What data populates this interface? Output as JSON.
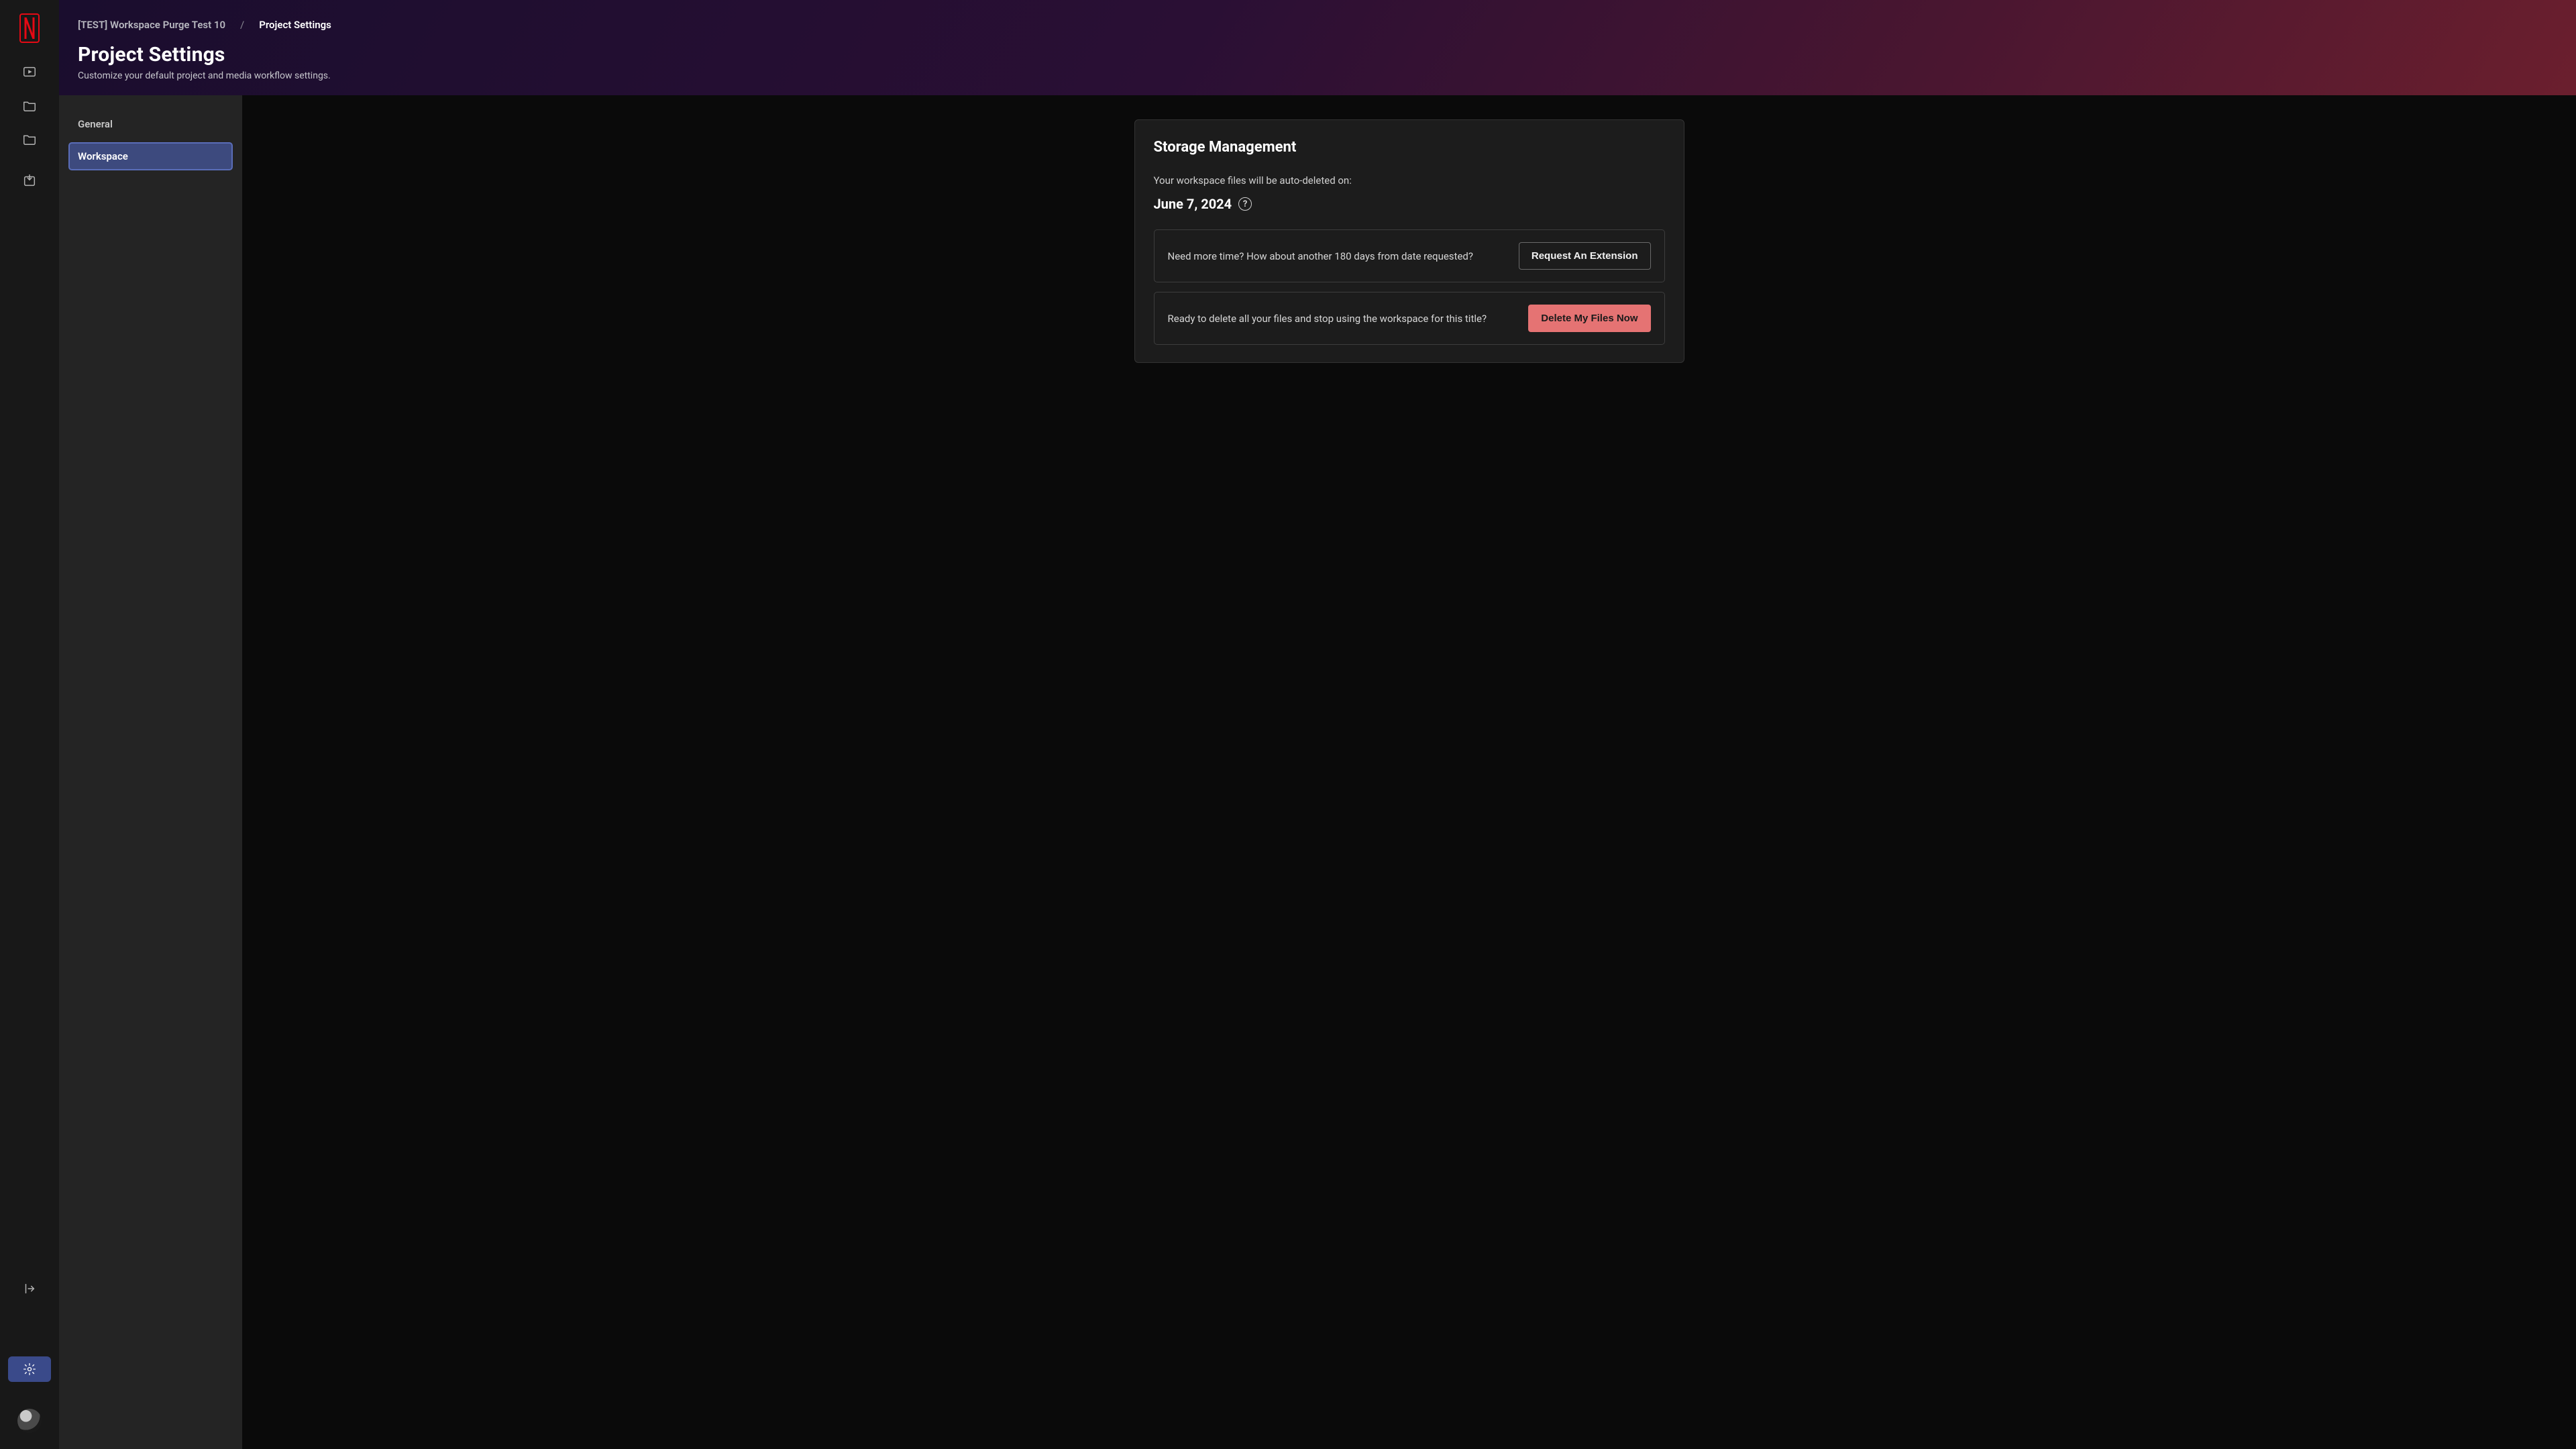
{
  "brand": {
    "letter": "N"
  },
  "breadcrumb": {
    "parent": "[TEST] Workspace Purge Test 10",
    "separator": "/",
    "current": "Project Settings"
  },
  "hero": {
    "title": "Project Settings",
    "subtitle": "Customize your default project and media workflow settings."
  },
  "settings_nav": {
    "items": [
      {
        "label": "General",
        "active": false
      },
      {
        "label": "Workspace",
        "active": true
      }
    ]
  },
  "storage": {
    "title": "Storage Management",
    "auto_delete_label": "Your workspace files will be auto-deleted on:",
    "auto_delete_date": "June 7, 2024",
    "help_glyph": "?",
    "extension": {
      "text": "Need more time? How about another 180 days from date requested?",
      "button": "Request An Extension"
    },
    "delete": {
      "text": "Ready to delete all your files and stop using the workspace for this title?",
      "button": "Delete My Files Now"
    }
  },
  "rail_icons": {
    "play": "play-icon",
    "folder1": "folder-icon",
    "folder2": "folder-icon",
    "import": "import-icon",
    "collapse": "collapse-icon",
    "settings": "gear-icon",
    "avatar": "avatar"
  },
  "colors": {
    "brand_red": "#e50914",
    "nav_active_bg": "#3d4a7e",
    "nav_active_border": "#5a6db8",
    "danger_btn": "#e57373"
  }
}
